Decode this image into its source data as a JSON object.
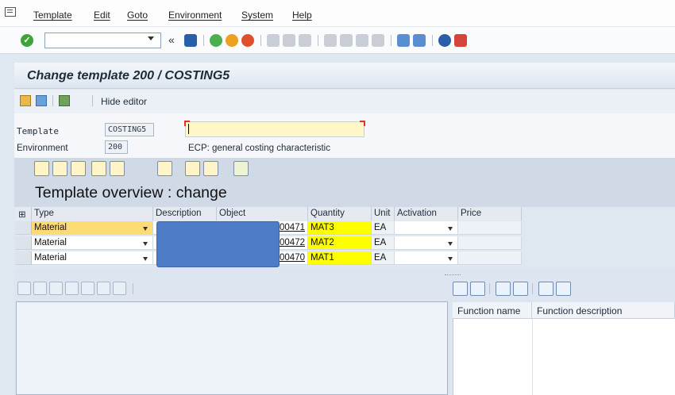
{
  "menu": {
    "items": [
      "Template",
      "Edit",
      "Goto",
      "Environment",
      "System",
      "Help"
    ]
  },
  "toolbar": {
    "command_field": "",
    "icons": [
      "enter-icon",
      "command-dropdown-icon",
      "back-arrows-icon",
      "save-icon",
      "back-icon",
      "exit-icon",
      "cancel-icon",
      "print-icon",
      "find-icon",
      "find-next-icon",
      "first-page-icon",
      "previous-page-icon",
      "next-page-icon",
      "last-page-icon",
      "create-session-icon",
      "shortcut-icon",
      "help-icon",
      "customize-layout-icon"
    ]
  },
  "title": "Change template 200 / COSTING5",
  "app_toolbar": {
    "hide_editor_label": "Hide editor"
  },
  "form": {
    "template_label": "Template",
    "template_value": "COSTING5",
    "template_text": "",
    "environment_label": "Environment",
    "environment_value": "200",
    "environment_desc": "ECP: general costing characteristic"
  },
  "overview": {
    "heading": "Template overview : change"
  },
  "table": {
    "columns": [
      "Type",
      "Description",
      "Object",
      "Quantity",
      "Unit",
      "Activation",
      "Price"
    ],
    "rows": [
      {
        "type": "Material",
        "description": "",
        "object": "00471",
        "quantity": "MAT3",
        "unit": "EA",
        "activation": "",
        "price": ""
      },
      {
        "type": "Material",
        "description": "",
        "object": "00472",
        "quantity": "MAT2",
        "unit": "EA",
        "activation": "",
        "price": ""
      },
      {
        "type": "Material",
        "description": "",
        "object": "00470",
        "quantity": "MAT1",
        "unit": "EA",
        "activation": "",
        "price": ""
      }
    ]
  },
  "functions": {
    "col_name": "Function name",
    "col_desc": "Function description"
  },
  "colors": {
    "accent": "#4f7cc7",
    "selected_row": "#ffdc73",
    "highlight": "#ffff00",
    "required_field": "#fff7c8"
  }
}
